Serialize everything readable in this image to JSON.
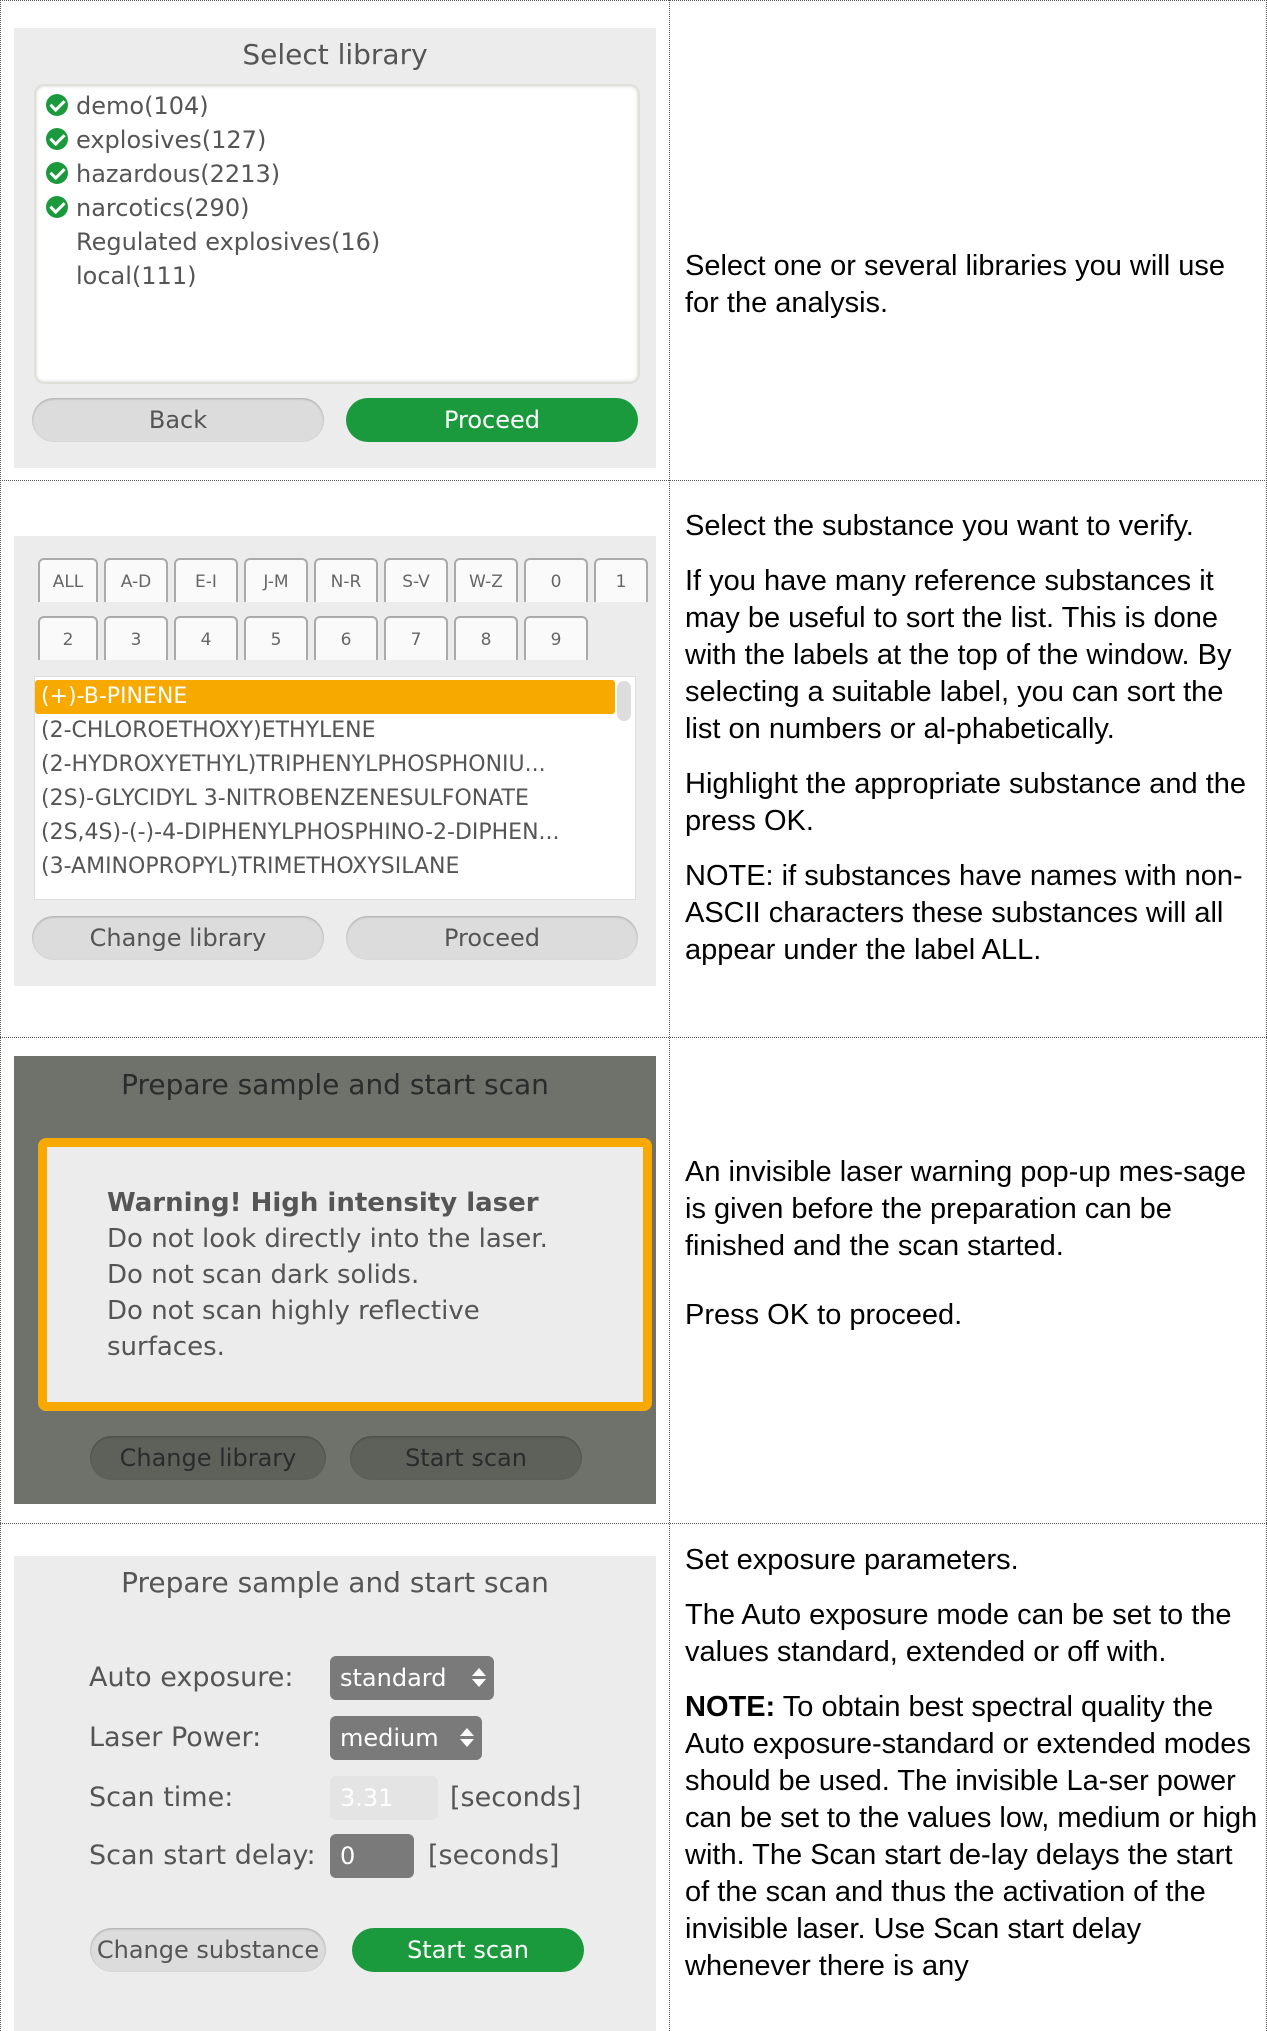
{
  "row1": {
    "screen_title": "Select library",
    "libraries": [
      {
        "label": "demo(104)",
        "checked": true
      },
      {
        "label": "explosives(127)",
        "checked": true
      },
      {
        "label": "hazardous(2213)",
        "checked": true
      },
      {
        "label": "narcotics(290)",
        "checked": true
      },
      {
        "label": "Regulated explosives(16)",
        "checked": false
      },
      {
        "label": "local(111)",
        "checked": false
      }
    ],
    "back_label": "Back",
    "proceed_label": "Proceed",
    "description": "Select one or several libraries you will use for the analysis."
  },
  "row2": {
    "tabs_row1": [
      "ALL",
      "A-D",
      "E-I",
      "J-M",
      "N-R",
      "S-V",
      "W-Z",
      "0",
      "1"
    ],
    "tabs_row2": [
      "2",
      "3",
      "4",
      "5",
      "6",
      "7",
      "8",
      "9"
    ],
    "substances": [
      "(+)-B-PINENE",
      "(2-CHLOROETHOXY)ETHYLENE",
      "(2-HYDROXYETHYL)TRIPHENYLPHOSPHONIU...",
      "(2S)-GLYCIDYL 3-NITROBENZENESULFONATE",
      "(2S,4S)-(-)-4-DIPHENYLPHOSPHINO-2-DIPHEN...",
      "(3-AMINOPROPYL)TRIMETHOXYSILANE"
    ],
    "change_library_label": "Change library",
    "proceed_label": "Proceed",
    "desc_p1": "Select the substance you want to verify.",
    "desc_p2": "If you have many reference substances it may be useful to sort the list. This is done with the labels at the top of the window. By selecting a suitable label, you can sort the list on numbers or al-phabetically.",
    "desc_p3": " Highlight the appropriate substance and the press OK.",
    "desc_p4": "NOTE: if substances have names with non-ASCII characters these substances will all appear under the label ALL."
  },
  "row3": {
    "screen_title": "Prepare sample and start scan",
    "warning_heading": "Warning! High intensity laser",
    "warning_lines": [
      "Do not look directly into the laser.",
      "Do not scan dark solids.",
      "Do not scan highly reflective",
      "surfaces."
    ],
    "change_library_label": "Change library",
    "start_scan_label": "Start scan",
    "desc_p1": "An invisible laser warning pop-up mes-sage is given before the preparation can be finished and the scan started.",
    "desc_p2": "Press OK to proceed."
  },
  "row4": {
    "screen_title": "Prepare sample and start scan",
    "auto_exposure_label": "Auto exposure:",
    "auto_exposure_value": "standard",
    "laser_power_label": "Laser Power:",
    "laser_power_value": "medium",
    "scan_time_label": "Scan time:",
    "scan_time_value": "3.31",
    "scan_time_unit": "[seconds]",
    "scan_delay_label": "Scan start delay:",
    "scan_delay_value": "0",
    "scan_delay_unit": "[seconds]",
    "change_substance_label": "Change substance",
    "start_scan_label": "Start scan",
    "desc_p1": "Set exposure parameters.",
    "desc_p2": "The Auto exposure mode can be set to the values standard, extended or off with.",
    "desc_note_bold": "NOTE:",
    "desc_note_text": " To obtain best spectral quality the Auto exposure-standard or extended modes should be used. The invisible La-ser power can be set to the values low, medium or high with. The Scan start de-lay delays the start of the scan and thus the activation of the invisible laser. Use Scan start delay whenever there is any"
  },
  "colors": {
    "green": "#1a9a3c",
    "orange": "#f8a900",
    "panel_bg": "#ececec",
    "overlay_bg": "#6f716b"
  }
}
